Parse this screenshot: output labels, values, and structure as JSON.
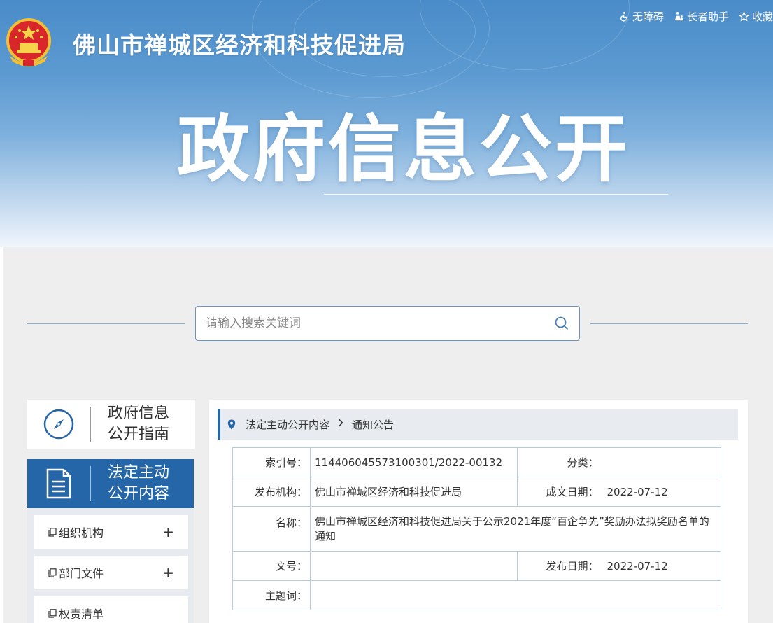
{
  "header": {
    "site_title": "佛山市禅城区经济和科技促进局",
    "banner_title": "政府信息公开",
    "links": [
      {
        "label": "无障碍",
        "icon": "wheelchair-icon"
      },
      {
        "label": "长者助手",
        "icon": "elder-icon"
      },
      {
        "label": "收藏",
        "icon": "star-icon"
      }
    ]
  },
  "search": {
    "placeholder": "请输入搜索关键词",
    "value": ""
  },
  "sidebar": {
    "guide_label_line1": "政府信息",
    "guide_label_line2": "公开指南",
    "legal_label_line1": "法定主动",
    "legal_label_line2": "公开内容",
    "items": [
      {
        "label": "组织机构",
        "expand": "+"
      },
      {
        "label": "部门文件",
        "expand": "+"
      },
      {
        "label": "权责清单"
      }
    ]
  },
  "breadcrumb": {
    "level1": "法定主动公开内容",
    "separator": ">",
    "level2": "通知公告"
  },
  "info_table": {
    "index_label": "索引号：",
    "index_value": "114406045573100301/2022-00132",
    "category_label": "分类：",
    "category_value": "",
    "publisher_label": "发布机构：",
    "publisher_value": "佛山市禅城区经济和科技促进局",
    "created_label": "成文日期：",
    "created_value": "2022-07-12",
    "name_label": "名称：",
    "name_value": "佛山市禅城区经济和科技促进局关于公示2021年度“百企争先”奖励办法拟奖励名单的通知",
    "docno_label": "文号：",
    "docno_value": "",
    "published_label": "发布日期：",
    "published_value": "2022-07-12",
    "keywords_label": "主题词：",
    "keywords_value": ""
  },
  "colors": {
    "primary": "#2566a8",
    "banner_top": "#4a8cc9",
    "table_border": "#b5ccdc"
  }
}
